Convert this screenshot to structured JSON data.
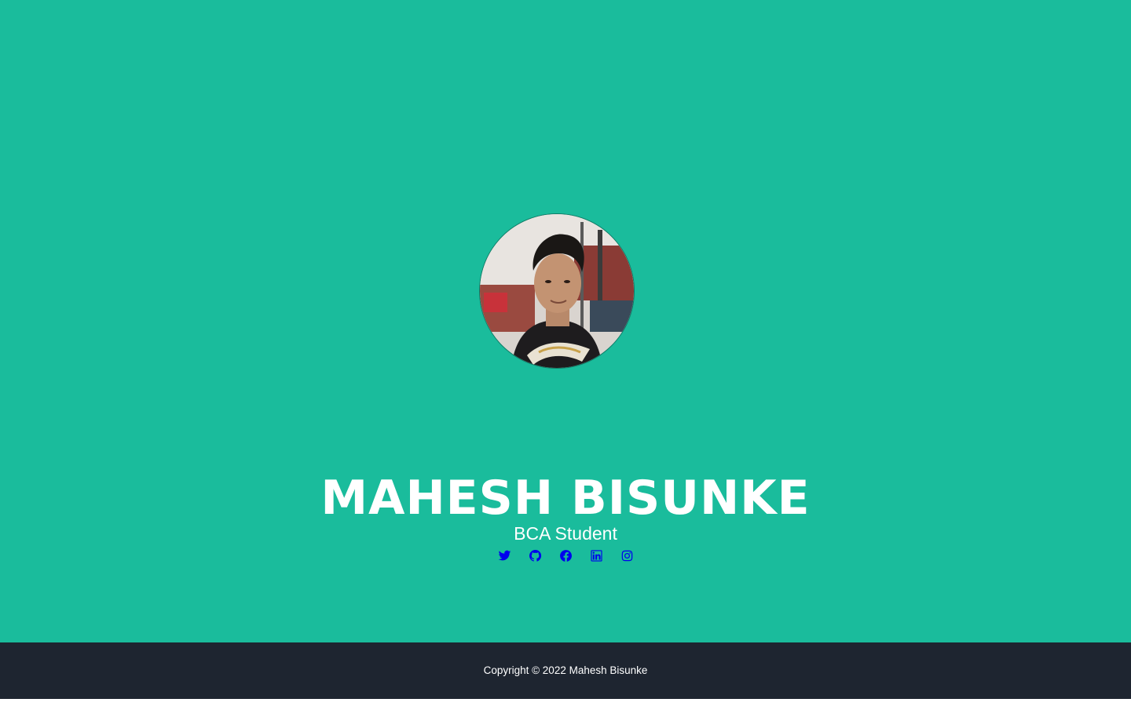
{
  "profile": {
    "name": "MAHESH BISUNKE",
    "role": "BCA Student",
    "avatar_alt": "profile photo"
  },
  "social": [
    {
      "icon": "twitter-icon"
    },
    {
      "icon": "github-icon"
    },
    {
      "icon": "facebook-icon"
    },
    {
      "icon": "linkedin-icon"
    },
    {
      "icon": "instagram-icon"
    }
  ],
  "footer": {
    "copyright": "Copyright © 2022 Mahesh Bisunke"
  },
  "colors": {
    "hero_bg": "#1abc9c",
    "footer_bg": "#1e2530",
    "text": "#ffffff",
    "link": "#0000ee"
  }
}
